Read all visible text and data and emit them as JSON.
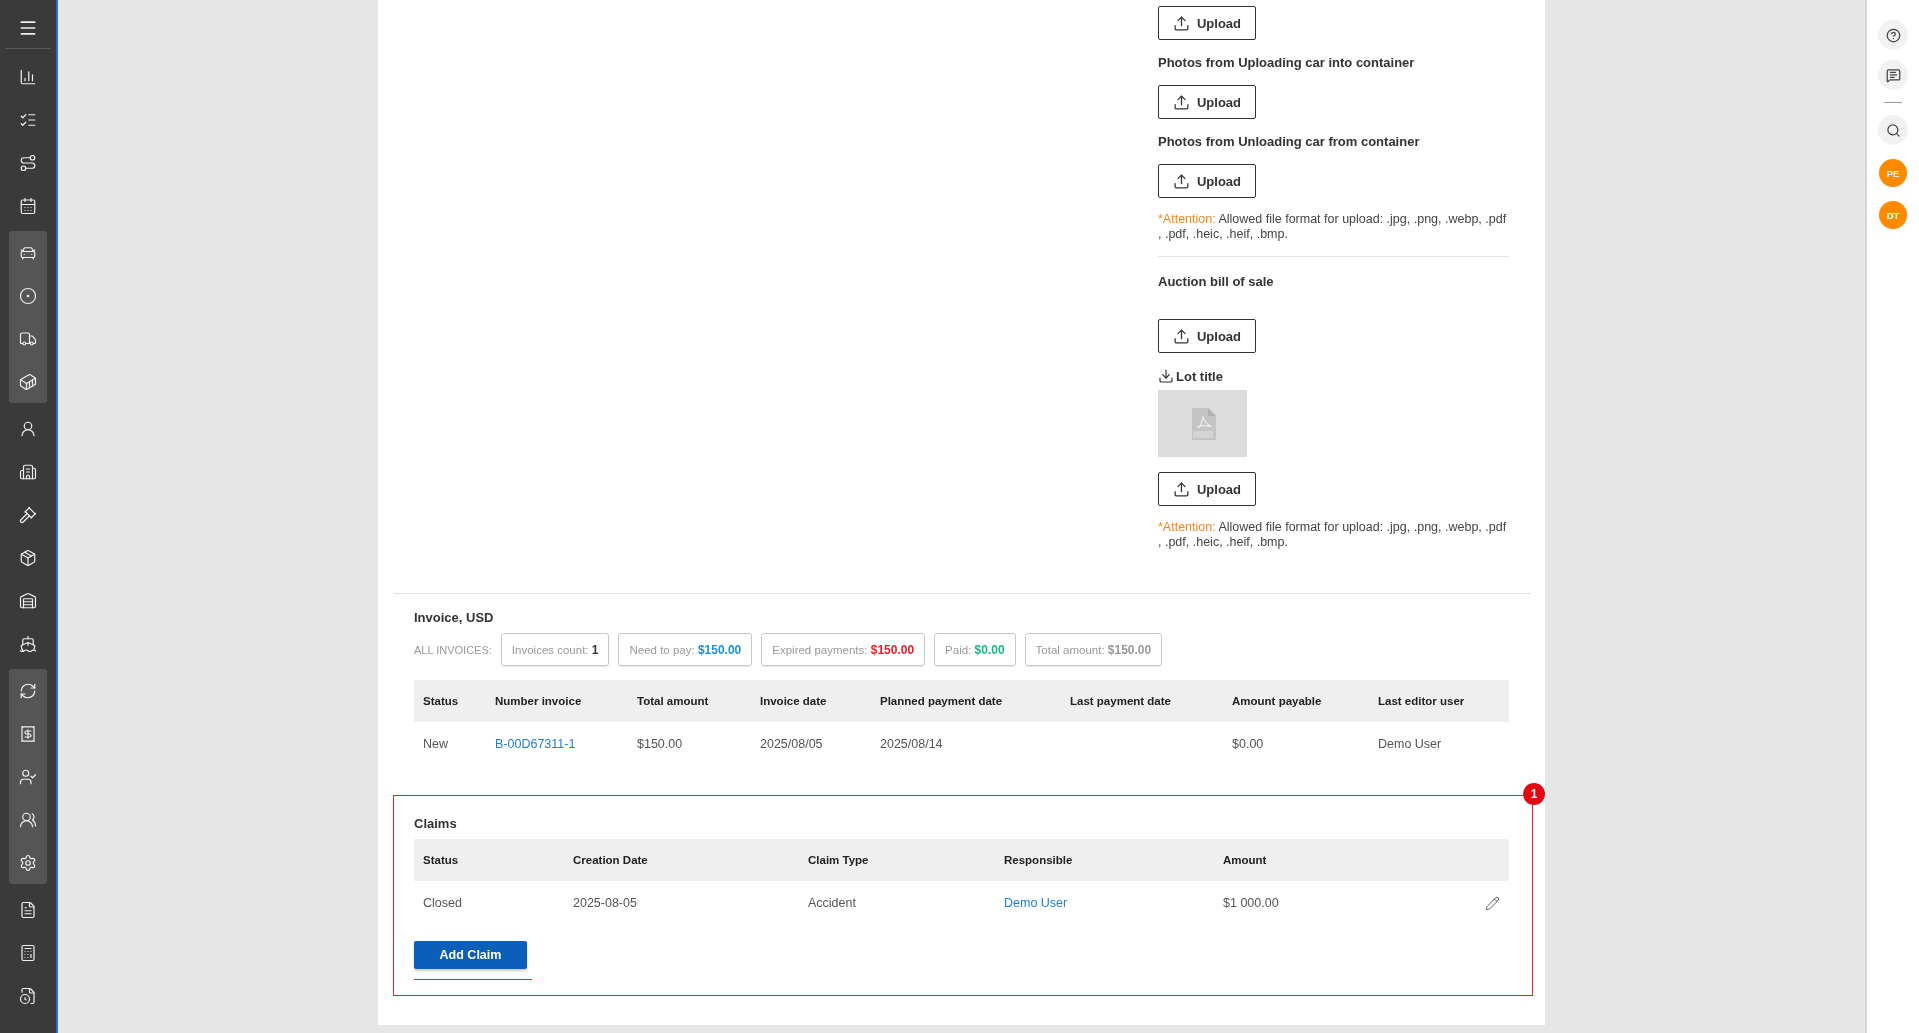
{
  "sidebar": {
    "items": [
      {
        "highlighted": false
      },
      {
        "highlighted": false
      },
      {
        "highlighted": false
      },
      {
        "highlighted": false
      },
      {
        "highlighted": true
      },
      {
        "highlighted": true
      },
      {
        "highlighted": true
      },
      {
        "highlighted": true
      },
      {
        "highlighted": false
      },
      {
        "highlighted": false
      },
      {
        "highlighted": false
      },
      {
        "highlighted": false
      },
      {
        "highlighted": false
      },
      {
        "highlighted": false
      },
      {
        "highlighted": true
      },
      {
        "highlighted": true
      },
      {
        "highlighted": true
      },
      {
        "highlighted": true
      },
      {
        "highlighted": true
      },
      {
        "highlighted": false
      },
      {
        "highlighted": false
      },
      {
        "highlighted": false
      }
    ]
  },
  "documents": [
    {
      "kind": "upload",
      "label": "Upload"
    },
    {
      "kind": "heading",
      "text": "Photos from Uploading car into container"
    },
    {
      "kind": "upload",
      "label": "Upload"
    },
    {
      "kind": "heading",
      "text": "Photos from Unloading car from container"
    },
    {
      "kind": "upload",
      "label": "Upload"
    },
    {
      "kind": "note",
      "prefix": "*Attention:",
      "text": " Allowed file format for upload: .jpg, .png, .webp, .pdf , .pdf, .heic, .heif, .bmp."
    },
    {
      "kind": "divider"
    },
    {
      "kind": "section",
      "text": "Auction bill of sale"
    },
    {
      "kind": "upload",
      "label": "Upload"
    },
    {
      "kind": "file",
      "text": "Lot title"
    },
    {
      "kind": "upload",
      "label": "Upload"
    },
    {
      "kind": "note",
      "prefix": "*Attention:",
      "text": " Allowed file format for upload: .jpg, .png, .webp, .pdf , .pdf, .heic, .heif, .bmp."
    }
  ],
  "invoice": {
    "title": "Invoice, USD",
    "summary_label": "ALL INVOICES:",
    "chips": [
      {
        "label": "Invoices count:",
        "value": "1",
        "color": "#333333"
      },
      {
        "label": "Need to pay:",
        "value": "$150.00",
        "color": "#1a8fe8"
      },
      {
        "label": "Expired payments:",
        "value": "$150.00",
        "color": "#e8202a"
      },
      {
        "label": "Paid:",
        "value": "$0.00",
        "color": "#17b890"
      },
      {
        "label": "Total amount:",
        "value": "$150.00",
        "color": "#999999"
      }
    ],
    "columns": [
      {
        "label": "Status",
        "kind": "text"
      },
      {
        "label": "Number invoice",
        "kind": "link"
      },
      {
        "label": "Total amount",
        "kind": "text"
      },
      {
        "label": "Invoice date",
        "kind": "text"
      },
      {
        "label": "Planned payment date",
        "kind": "text"
      },
      {
        "label": "Last payment date",
        "kind": "text"
      },
      {
        "label": "Amount payable",
        "kind": "text"
      },
      {
        "label": "Last editor user",
        "kind": "text"
      }
    ],
    "rows": [
      {
        "cells": [
          "New",
          "B-00D67311-1",
          "$150.00",
          "2025/08/05",
          "2025/08/14",
          null,
          "$0.00",
          "Demo User"
        ]
      }
    ]
  },
  "claims": {
    "title": "Claims",
    "columns": [
      {
        "label": "Status",
        "kind": "text"
      },
      {
        "label": "Creation Date",
        "kind": "text"
      },
      {
        "label": "Claim Type",
        "kind": "text"
      },
      {
        "label": "Responsible",
        "kind": "link"
      },
      {
        "label": "Amount",
        "kind": "text"
      }
    ],
    "rows": [
      {
        "cells": [
          "Closed",
          "2025-08-05",
          "Accident",
          "Demo User",
          "$1 000.00"
        ],
        "editable": true
      }
    ],
    "add_button": "Add Claim",
    "annotation": {
      "number": "1"
    }
  },
  "right_bar": {
    "avatars": [
      {
        "initials": "PE"
      },
      {
        "initials": "DT"
      }
    ]
  }
}
